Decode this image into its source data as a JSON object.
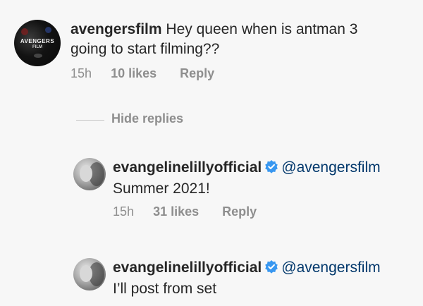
{
  "comments": [
    {
      "username": "avengersfilm",
      "avatar_text": "AVENGERS",
      "avatar_sub": "FILM",
      "text_line1": "Hey queen when is antman 3",
      "text_line2": "going to start filming??",
      "time": "15h",
      "likes": "10 likes",
      "reply": "Reply"
    }
  ],
  "hide_replies": "Hide replies",
  "replies": [
    {
      "username": "evangelinelillyofficial",
      "verified": true,
      "mention": "@avengersfilm",
      "text": "Summer 2021!",
      "time": "15h",
      "likes": "31 likes",
      "reply": "Reply"
    },
    {
      "username": "evangelinelillyofficial",
      "verified": true,
      "mention": "@avengersfilm",
      "text": "I’ll post from set"
    }
  ],
  "colors": {
    "verified_badge": "#3897f0",
    "mention": "#00376b",
    "meta": "#8e8e8e"
  }
}
